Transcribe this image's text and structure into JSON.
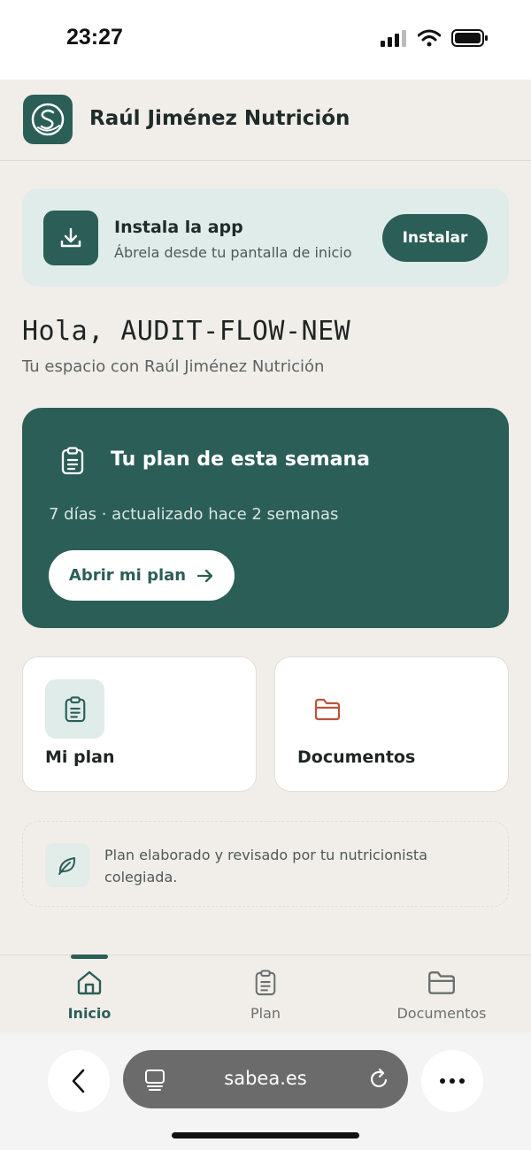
{
  "status_bar": {
    "time": "23:27"
  },
  "header": {
    "title": "Raúl Jiménez Nutrición",
    "logo_icon": "sabea-logo-icon"
  },
  "install_card": {
    "title": "Instala la app",
    "subtitle": "Ábrela desde tu pantalla de inicio",
    "button_label": "Instalar",
    "icon": "download-icon"
  },
  "greeting": {
    "title": "Hola, AUDIT-FLOW-NEW",
    "subtitle": "Tu espacio con Raúl Jiménez Nutrición"
  },
  "plan_card": {
    "title": "Tu plan de esta semana",
    "meta": "7 días · actualizado hace 2 semanas",
    "button_label": "Abrir mi plan",
    "icon": "clipboard-icon"
  },
  "tiles": [
    {
      "label": "Mi plan",
      "icon": "clipboard-icon"
    },
    {
      "label": "Documentos",
      "icon": "folder-icon"
    }
  ],
  "note": {
    "text": "Plan elaborado y revisado por tu nutricionista colegiada.",
    "icon": "leaf-icon"
  },
  "bottom_nav": [
    {
      "label": "Inicio",
      "icon": "home-icon",
      "active": true
    },
    {
      "label": "Plan",
      "icon": "clipboard-icon",
      "active": false
    },
    {
      "label": "Documentos",
      "icon": "folder-icon",
      "active": false
    }
  ],
  "browser": {
    "url": "sabea.es"
  },
  "colors": {
    "brand": "#2b5e56",
    "accent_soft": "#dfecea",
    "folder": "#c0513b",
    "background": "#f1eeea"
  }
}
